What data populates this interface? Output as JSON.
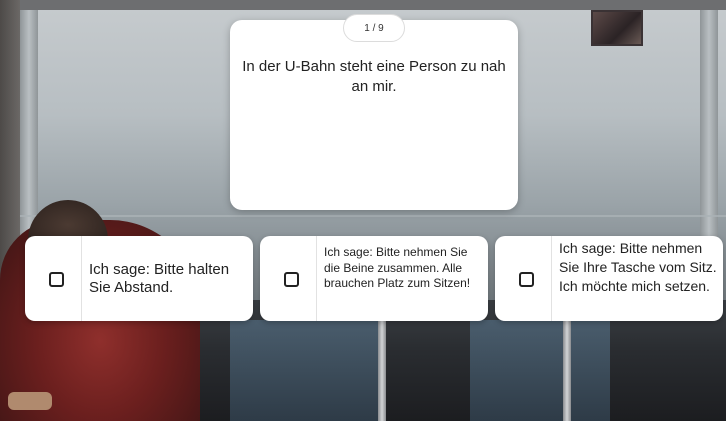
{
  "quiz": {
    "progress": "1 / 9",
    "question": "In der U-Bahn steht eine Person zu nah an mir."
  },
  "answers": [
    {
      "label": "Ich sage: Bitte hal­ten Sie Abstand.",
      "checked": false
    },
    {
      "label": "Ich sage: Bitte neh­men Sie die Beine zu­sammen. Alle brau­chen Platz zum Sitzen!",
      "checked": false
    },
    {
      "label": "Ich sage: Bitte neh­men Sie Ihre Tasche vom Sitz. Ich möchte mich setzen.",
      "checked": false
    }
  ],
  "icons": {
    "checkbox": "checkbox-empty-icon"
  },
  "colors": {
    "card_background": "#ffffff",
    "text": "#222222"
  }
}
